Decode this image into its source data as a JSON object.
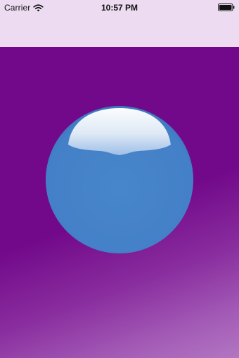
{
  "status_bar": {
    "carrier": "Carrier",
    "time": "10:57 PM",
    "wifi_icon": "wifi-icon",
    "battery_icon": "battery-icon",
    "battery_level": 1.0
  },
  "colors": {
    "nav_background": "#eddcf1",
    "content_background": "#72098a",
    "content_gradient_end": "#b276c2",
    "orb": "#4683c9",
    "orb_highlight": "#ffffff"
  },
  "orb": {
    "icon": "glossy-orb"
  }
}
